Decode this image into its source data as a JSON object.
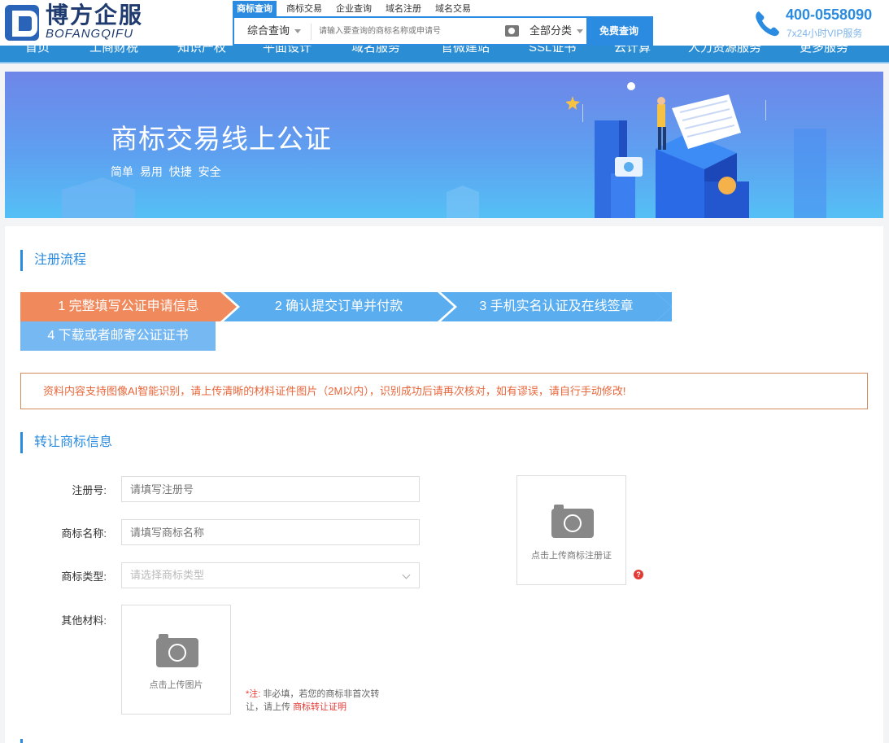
{
  "brand": {
    "name_cn": "博方企服",
    "name_en": "BOFANGQIFU"
  },
  "search": {
    "tabs": [
      "商标查询",
      "商标交易",
      "企业查询",
      "域名注册",
      "域名交易"
    ],
    "type_label": "综合查询",
    "placeholder": "请输入要查询的商标名称或申请号",
    "category_label": "全部分类",
    "button_label": "免费查询"
  },
  "contact": {
    "phone": "400-0558090",
    "service": "7x24小时VIP服务"
  },
  "nav": {
    "items": [
      "首页",
      "工商财税",
      "知识产权",
      "平面设计",
      "域名服务",
      "官微建站",
      "SSL证书",
      "云计算",
      "人力资源服务",
      "更多服务"
    ]
  },
  "banner": {
    "title": "商标交易线上公证",
    "subtitle": "简单 易用 快捷 安全"
  },
  "process": {
    "title": "注册流程",
    "steps": [
      "1 完整填写公证申请信息",
      "2 确认提交订单并付款",
      "3 手机实名认证及在线签章",
      "4 下载或者邮寄公证证书"
    ],
    "colors": {
      "active": "#f08a5d",
      "pending": "#5aaef0"
    }
  },
  "notice": "资料内容支持图像AI智能识别，请上传清晰的材料证件图片（2M以内），识别成功后请再次核对，如有谬误，请自行手动修改!",
  "form": {
    "title": "转让商标信息",
    "reg_no": {
      "label": "注册号:",
      "placeholder": "请填写注册号"
    },
    "tm_name": {
      "label": "商标名称:",
      "placeholder": "请填写商标名称"
    },
    "tm_type": {
      "label": "商标类型:",
      "placeholder": "请选择商标类型"
    },
    "other": {
      "label": "其他材料:"
    },
    "upload_cert": "点击上传商标注册证",
    "upload_image": "点击上传图片",
    "help_icon": "?",
    "note_prefix": "*注:",
    "note_text": " 非必填，若您的商标非首次转让，请上传 ",
    "note_link": "商标转让证明"
  },
  "accent_color": "#2a8be0"
}
